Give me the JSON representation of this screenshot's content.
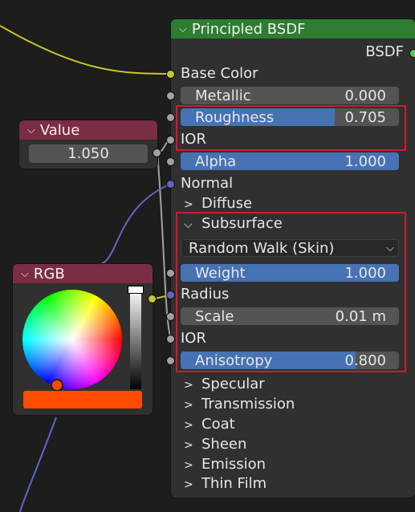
{
  "principled_bsdf": {
    "title": "Principled BSDF",
    "output_label": "BSDF",
    "inputs": {
      "base_color": "Base Color",
      "metallic": {
        "label": "Metallic",
        "value": "0.000",
        "fill": 0
      },
      "roughness": {
        "label": "Roughness",
        "value": "0.705",
        "fill": 0.705
      },
      "ior": "IOR",
      "alpha": {
        "label": "Alpha",
        "value": "1.000",
        "fill": 1
      },
      "normal": "Normal"
    },
    "panels": {
      "diffuse": "Diffuse",
      "subsurface": {
        "label": "Subsurface",
        "method": "Random Walk (Skin)",
        "weight": {
          "label": "Weight",
          "value": "1.000",
          "fill": 1
        },
        "radius": "Radius",
        "scale": {
          "label": "Scale",
          "value": "0.01 m",
          "fill": 0
        },
        "ior": "IOR",
        "anisotropy": {
          "label": "Anisotropy",
          "value": "0.800",
          "fill": 0.8
        }
      },
      "specular": "Specular",
      "transmission": "Transmission",
      "coat": "Coat",
      "sheen": "Sheen",
      "emission": "Emission",
      "thin_film": "Thin Film"
    }
  },
  "value_node": {
    "title": "Value",
    "value": "1.050"
  },
  "rgb_node": {
    "title": "RGB",
    "color": "#ff4b00"
  },
  "colors": {
    "bsdf_header": "#2e7d32",
    "value_header": "#7b2d44",
    "rgb_header": "#7b2d44",
    "socket_yellow": "#c7c729",
    "socket_gray": "#a1a1a1",
    "socket_purple": "#6363c7",
    "socket_green": "#63c763",
    "field_blue": "#4772b3",
    "highlight_red": "#d31a2f"
  }
}
